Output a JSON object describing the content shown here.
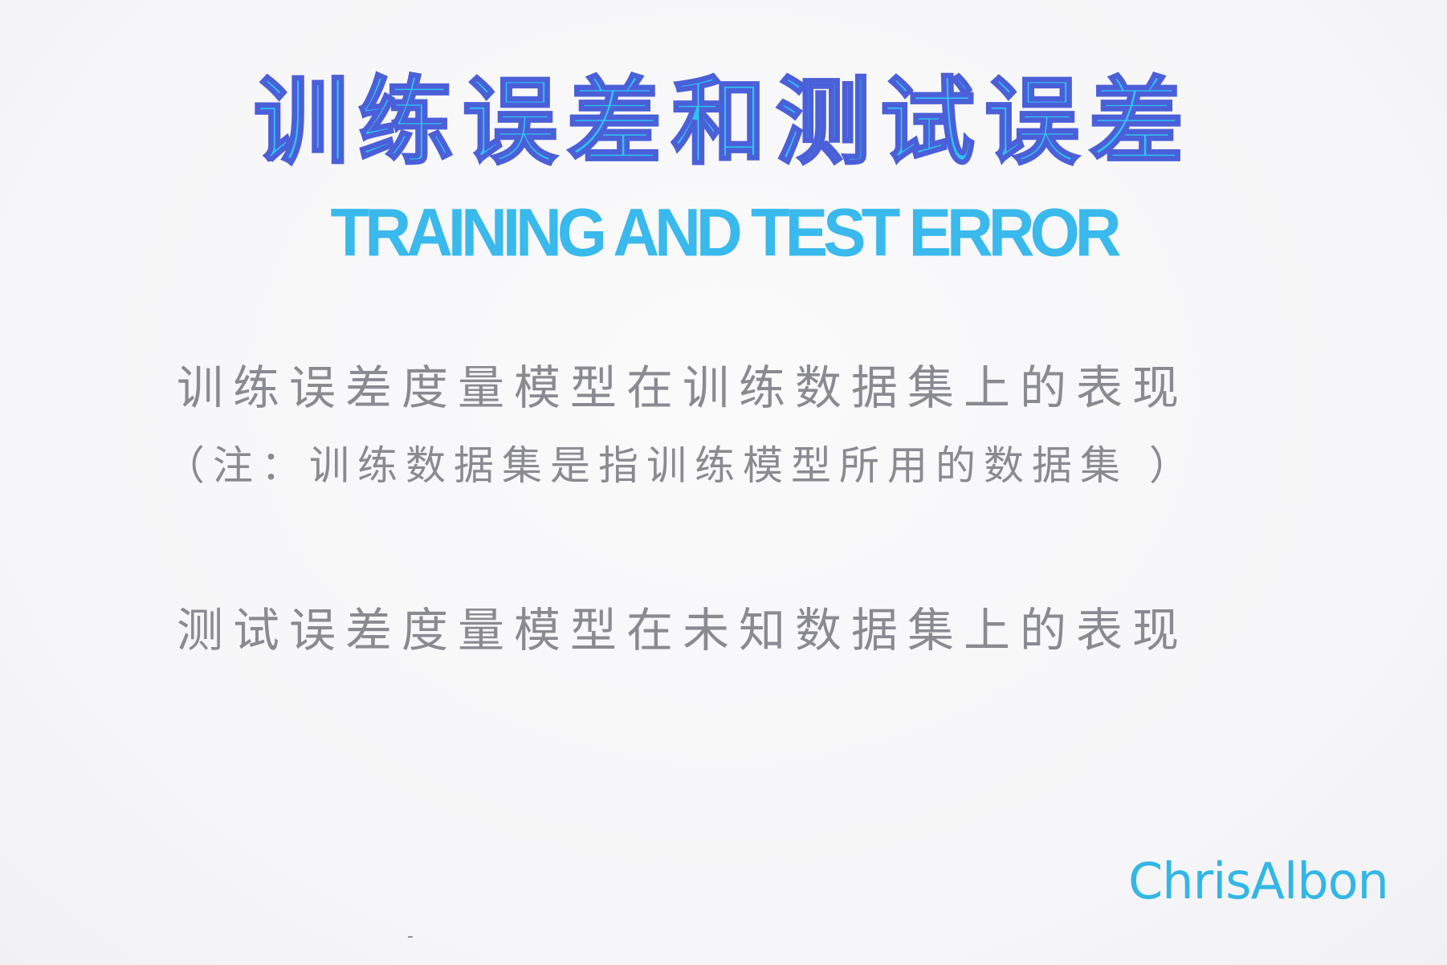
{
  "title": {
    "chinese": "训练误差和测试误差",
    "english": "TRAINING AND TEST ERROR"
  },
  "body": {
    "training_error_line": "训练误差度量模型在训练数据集上的表现",
    "training_note_line": "（注：训练数据集是指训练模型所用的数据集 ）",
    "test_error_line": "测试误差度量模型在未知数据集上的表现"
  },
  "signature": "ChrisAlbon",
  "colors": {
    "title_fill": "#2ec3f2",
    "title_outline": "#4b5fd8",
    "body_text": "#8a8a91",
    "signature": "#33b6e6",
    "background": "#f7f7f9"
  }
}
